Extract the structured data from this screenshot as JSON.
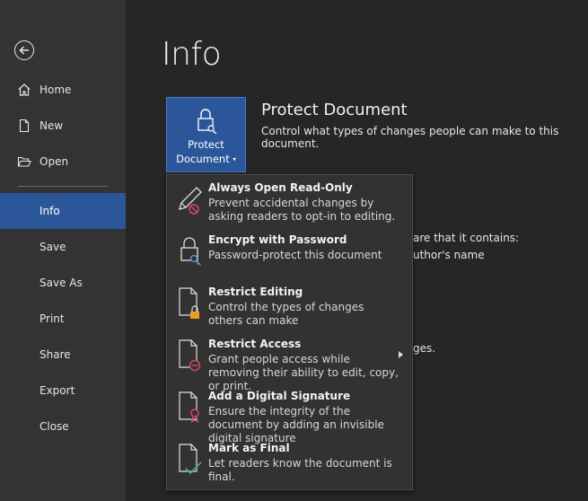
{
  "sidebar": {
    "items": [
      {
        "label": "Home"
      },
      {
        "label": "New"
      },
      {
        "label": "Open"
      },
      {
        "label": "Info"
      },
      {
        "label": "Save"
      },
      {
        "label": "Save As"
      },
      {
        "label": "Print"
      },
      {
        "label": "Share"
      },
      {
        "label": "Export"
      },
      {
        "label": "Close"
      }
    ]
  },
  "main": {
    "title": "Info",
    "protect_button": {
      "line1": "Protect",
      "line2": "Document",
      "caret": "▾"
    },
    "protect_section": {
      "title": "Protect Document",
      "description": "Control what types of changes people can make to this document."
    },
    "behind_text": {
      "line1": "are that it contains:",
      "line2": "uthor's name",
      "line3": "ges."
    }
  },
  "dropdown": {
    "items": [
      {
        "title": "Always Open Read-Only",
        "description": "Prevent accidental changes by asking readers to opt-in to editing.",
        "icon": "pencil-no-icon"
      },
      {
        "title": "Encrypt with Password",
        "description": "Password-protect this document",
        "icon": "lock-key-icon"
      },
      {
        "title": "Restrict Editing",
        "description": "Control the types of changes others can make",
        "icon": "document-lock-icon"
      },
      {
        "title": "Restrict Access",
        "description": "Grant people access while removing their ability to edit, copy, or print.",
        "icon": "document-restrict-icon"
      },
      {
        "title": "Add a Digital Signature",
        "description": "Ensure the integrity of the document by adding an invisible digital signature",
        "icon": "document-ribbon-icon"
      },
      {
        "title": "Mark as Final",
        "description": "Let readers know the document is final.",
        "icon": "document-check-icon"
      }
    ]
  },
  "colors": {
    "sidebar_bg": "#333333",
    "active_bg": "#2b579a",
    "page_bg": "#262626",
    "menu_bg": "#323232"
  }
}
